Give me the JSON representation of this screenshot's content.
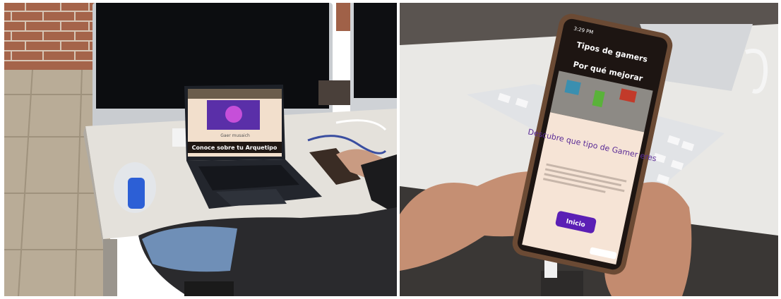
{
  "left_photo": {
    "laptop_screen": {
      "hero_caption": "Gaer musaich",
      "banner_text": "Conoce sobre tu Arquetipo"
    }
  },
  "right_photo": {
    "phone_status": {
      "time": "3:29 PM"
    },
    "phone_app": {
      "header_title": "Tipos de gamers",
      "subtitle": "Por qué mejorar",
      "heading": "Descubre que tipo de Gamer eres",
      "start_button": "Inicio"
    }
  },
  "colors": {
    "purple_button": "#5b1fb5",
    "heading_purple": "#5a2b96",
    "app_bg": "#f6e4d6",
    "dark_header": "#1d1512"
  }
}
